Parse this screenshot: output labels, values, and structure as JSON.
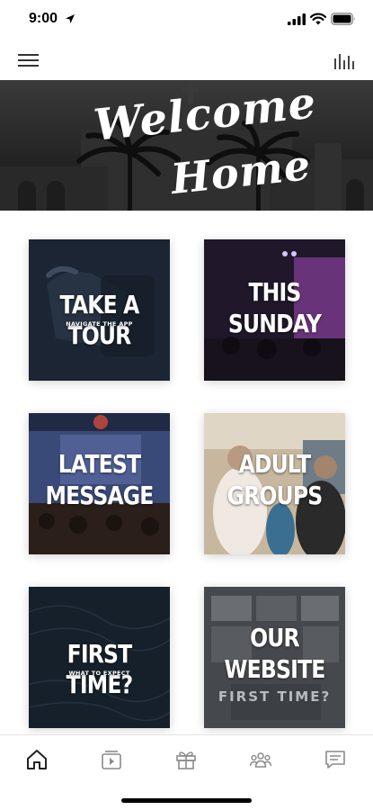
{
  "status_bar": {
    "time": "9:00",
    "icons": [
      "location-arrow-icon",
      "signal-bars-icon",
      "wifi-icon",
      "battery-icon"
    ]
  },
  "nav_bar": {
    "left_icon": "hamburger-menu-icon",
    "right_icon": "audio-bars-icon"
  },
  "banner": {
    "line1": "Welcome",
    "line2": "Home"
  },
  "tiles": [
    {
      "title": "TAKE A TOUR",
      "subtitle": "NAVIGATE THE APP"
    },
    {
      "title_line1": "THIS",
      "title_line2": "SUNDAY"
    },
    {
      "title_line1": "LATEST",
      "title_line2": "MESSAGE"
    },
    {
      "title_line1": "ADULT",
      "title_line2": "GROUPS"
    },
    {
      "title": "FIRST TIME?",
      "subtitle": "WHAT TO EXPECT"
    },
    {
      "title_line1": "OUR",
      "title_line2": "WEBSITE",
      "background_text": "FIRST TIME?"
    }
  ],
  "tab_bar": {
    "items": [
      {
        "icon": "home-icon",
        "active": true
      },
      {
        "icon": "media-play-icon",
        "active": false
      },
      {
        "icon": "gift-icon",
        "active": false
      },
      {
        "icon": "people-group-icon",
        "active": false
      },
      {
        "icon": "chat-message-icon",
        "active": false
      }
    ]
  },
  "colors": {
    "active_tab": "#222222",
    "inactive_tab": "#8a8a8a",
    "banner_bg": "#262626"
  }
}
